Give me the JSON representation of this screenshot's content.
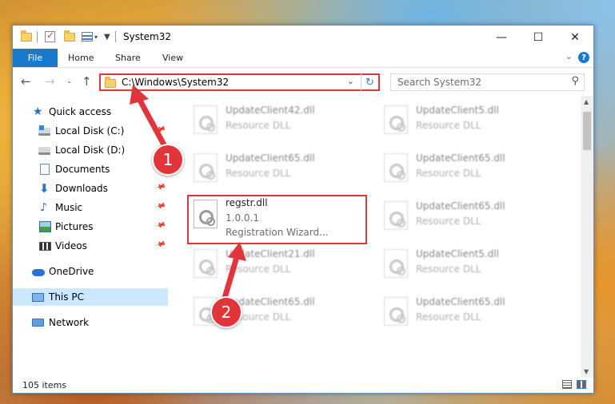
{
  "window": {
    "title": "System32",
    "controls": {
      "minimize": "—",
      "maximize": "☐",
      "close": "✕"
    }
  },
  "ribbon": {
    "file_tab": "File",
    "tabs": [
      "Home",
      "Share",
      "View"
    ],
    "help_icon": "?"
  },
  "address_bar": {
    "path": "C:\\Windows\\System32",
    "dropdown_icon": "chevron-down-icon",
    "refresh_icon": "refresh-icon"
  },
  "search": {
    "placeholder": "Search System32"
  },
  "navigation": {
    "items": [
      {
        "label": "Quick access",
        "icon": "star-icon",
        "pinned": false
      },
      {
        "label": "Local Disk (C:)",
        "icon": "drive-icon",
        "pinned": true
      },
      {
        "label": "Local Disk (D:)",
        "icon": "drive-icon",
        "pinned": true
      },
      {
        "label": "Documents",
        "icon": "documents-icon",
        "pinned": true
      },
      {
        "label": "Downloads",
        "icon": "downloads-icon",
        "pinned": true
      },
      {
        "label": "Music",
        "icon": "music-icon",
        "pinned": true
      },
      {
        "label": "Pictures",
        "icon": "pictures-icon",
        "pinned": true
      },
      {
        "label": "Videos",
        "icon": "videos-icon",
        "pinned": true
      },
      {
        "label": "OneDrive",
        "icon": "onedrive-icon",
        "pinned": false
      },
      {
        "label": "This PC",
        "icon": "pc-icon",
        "pinned": false,
        "selected": true
      },
      {
        "label": "Network",
        "icon": "network-icon",
        "pinned": false
      }
    ]
  },
  "files": [
    {
      "name": "UpdateClient42.dll",
      "type": "Resource DLL",
      "blurred": true
    },
    {
      "name": "UpdateClient5.dll",
      "type": "Resource DLL",
      "blurred": true
    },
    {
      "name": "UpdateClient65.dll",
      "type": "Resource DLL",
      "blurred": true
    },
    {
      "name": "UpdateClient65.dll",
      "type": "Resource DLL",
      "blurred": true
    },
    {
      "name": "regstr.dll",
      "version": "1.0.0.1",
      "description": "Registration Wizard...",
      "blurred": false,
      "highlighted": true
    },
    {
      "name": "UpdateClient65.dll",
      "type": "Resource DLL",
      "blurred": true
    },
    {
      "name": "UpdateClient21.dll",
      "type": "Resource DLL",
      "blurred": true
    },
    {
      "name": "UpdateClient5.dll",
      "type": "Resource DLL",
      "blurred": true
    },
    {
      "name": "UpdateClient65.dll",
      "type": "Resource DLL",
      "blurred": true
    },
    {
      "name": "UpdateClient65.dll",
      "type": "Resource DLL",
      "blurred": true
    }
  ],
  "status_bar": {
    "item_count": "105 items"
  },
  "annotations": {
    "step1": "1",
    "step2": "2",
    "color": "#e0353b"
  }
}
